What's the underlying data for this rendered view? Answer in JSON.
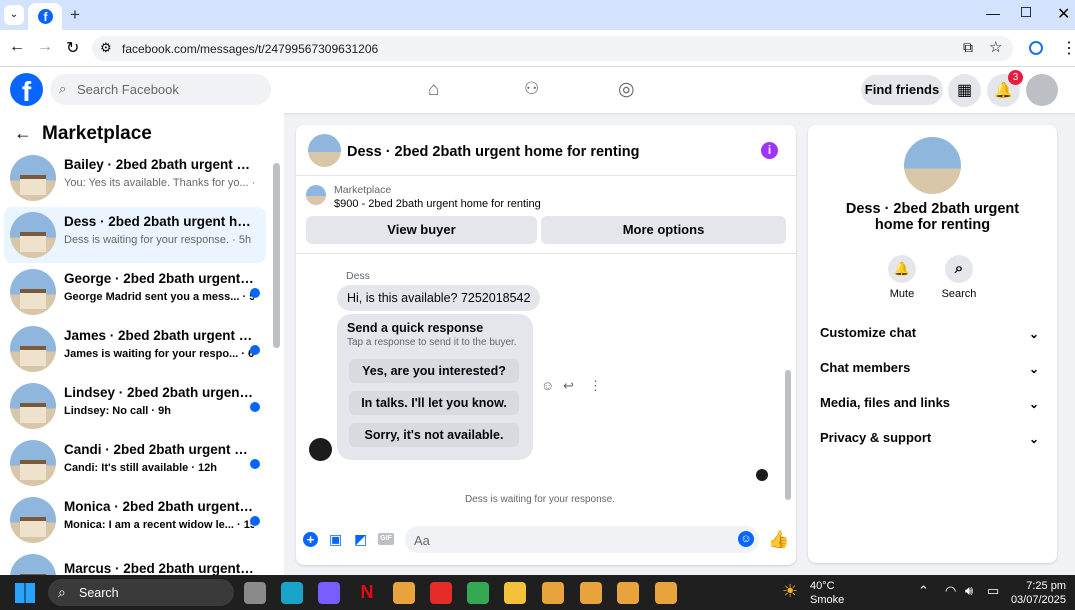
{
  "browser": {
    "url": "facebook.com/messages/t/24799567309631206"
  },
  "fb_header": {
    "search_placeholder": "Search Facebook",
    "find_friends": "Find friends",
    "notification_count": "3"
  },
  "left": {
    "title": "Marketplace",
    "conversations": [
      {
        "name": "Bailey · 2bed 2bath urgent hom...",
        "preview": "You: Yes its available. Thanks for yo... · 1m",
        "unread": false
      },
      {
        "name": "Dess · 2bed 2bath urgent home ...",
        "preview": "Dess is waiting for your response. · 5h",
        "unread": false
      },
      {
        "name": "George · 2bed 2bath urgent h...",
        "preview": "George Madrid sent you a mess... · 5h",
        "unread": true
      },
      {
        "name": "James · 2bed 2bath urgent ho...",
        "preview": "James is waiting for your respo... · 6h",
        "unread": true
      },
      {
        "name": "Lindsey · 2bed 2bath urgent h...",
        "preview": "Lindsey: No call · 9h",
        "unread": true
      },
      {
        "name": "Candi · 2bed 2bath urgent ho...",
        "preview": "Candi: It's still available · 12h",
        "unread": true
      },
      {
        "name": "Monica · 2bed 2bath urgent h...",
        "preview": "Monica: I am a recent widow le... · 15h",
        "unread": true
      },
      {
        "name": "Marcus · 2bed 2bath urgent ho...",
        "preview": "",
        "unread": true
      }
    ]
  },
  "chat": {
    "title": "Dess · 2bed 2bath urgent home for renting",
    "listing_label": "Marketplace",
    "listing_desc": "$900 - 2bed 2bath urgent home for renting",
    "view_buyer": "View buyer",
    "more_options": "More options",
    "sender": "Dess",
    "message": "Hi, is this available? 7252018542",
    "quick_title": "Send a quick response",
    "quick_sub": "Tap a response to send it to the buyer.",
    "quick_replies": [
      "Yes, are you interested?",
      "In talks. I'll let you know.",
      "Sorry, it's not available."
    ],
    "status": "Dess is waiting for your response.",
    "input_placeholder": "Aa"
  },
  "right": {
    "title": "Dess · 2bed 2bath urgent home for renting",
    "mute": "Mute",
    "search": "Search",
    "sections": [
      "Customize chat",
      "Chat members",
      "Media, files and links",
      "Privacy & support"
    ]
  },
  "taskbar": {
    "search": "Search",
    "temp": "40°C",
    "weather": "Smoke",
    "time": "7:25 pm",
    "date": "03/07/2025"
  },
  "colors": {
    "fb_blue": "#0866ff",
    "purple_info": "#a033ff",
    "unread_dot": "#0866ff"
  }
}
